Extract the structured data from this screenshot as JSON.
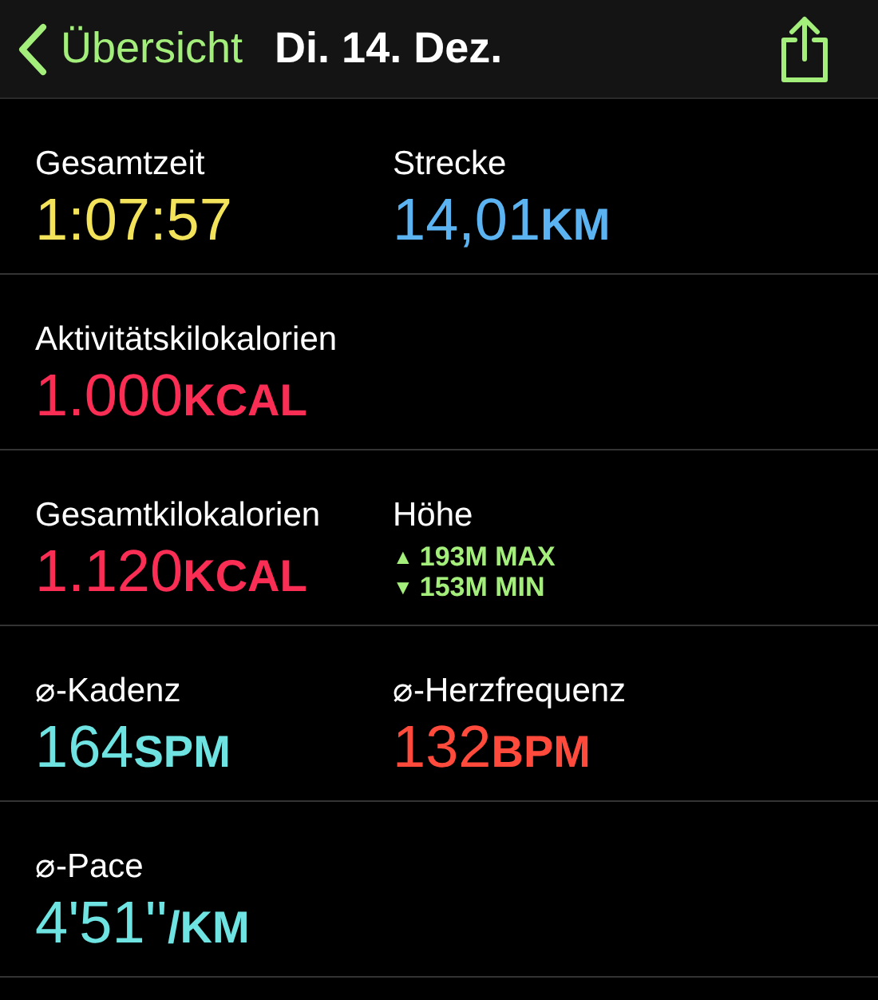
{
  "nav": {
    "back_label": "Übersicht",
    "title": "Di. 14. Dez."
  },
  "rows": [
    {
      "cells": [
        {
          "kind": "metric",
          "label": "Gesamtzeit",
          "value": "1:07:57",
          "color": "#f3e35b"
        },
        {
          "kind": "metric",
          "label": "Strecke",
          "value": "14,01",
          "unit": "KM",
          "color": "#5cb3f2"
        }
      ]
    },
    {
      "cells": [
        {
          "kind": "metric",
          "label": "Aktivitätskilokalorien",
          "value": "1.000",
          "unit": "KCAL",
          "color": "#fa2d55"
        }
      ]
    },
    {
      "cells": [
        {
          "kind": "metric",
          "label": "Gesamtkilokalorien",
          "value": "1.120",
          "unit": "KCAL",
          "color": "#fa2d55"
        },
        {
          "kind": "elevation",
          "label": "Höhe",
          "lines": [
            {
              "arrow": "▲",
              "text": "193M MAX"
            },
            {
              "arrow": "▼",
              "text": "153M MIN"
            }
          ],
          "color": "#a4ee7c"
        }
      ]
    },
    {
      "cells": [
        {
          "kind": "metric",
          "label": "⌀-Kadenz",
          "value": "164",
          "unit": "SPM",
          "color": "#6fe3e1"
        },
        {
          "kind": "metric",
          "label": "⌀-Herzfrequenz",
          "value": "132",
          "unit": "BPM",
          "color": "#ff4a3c"
        }
      ]
    },
    {
      "cells": [
        {
          "kind": "metric",
          "label": "⌀-Pace",
          "value": "4'51''",
          "unit": "/KM",
          "color": "#6fe3e1"
        }
      ]
    }
  ]
}
